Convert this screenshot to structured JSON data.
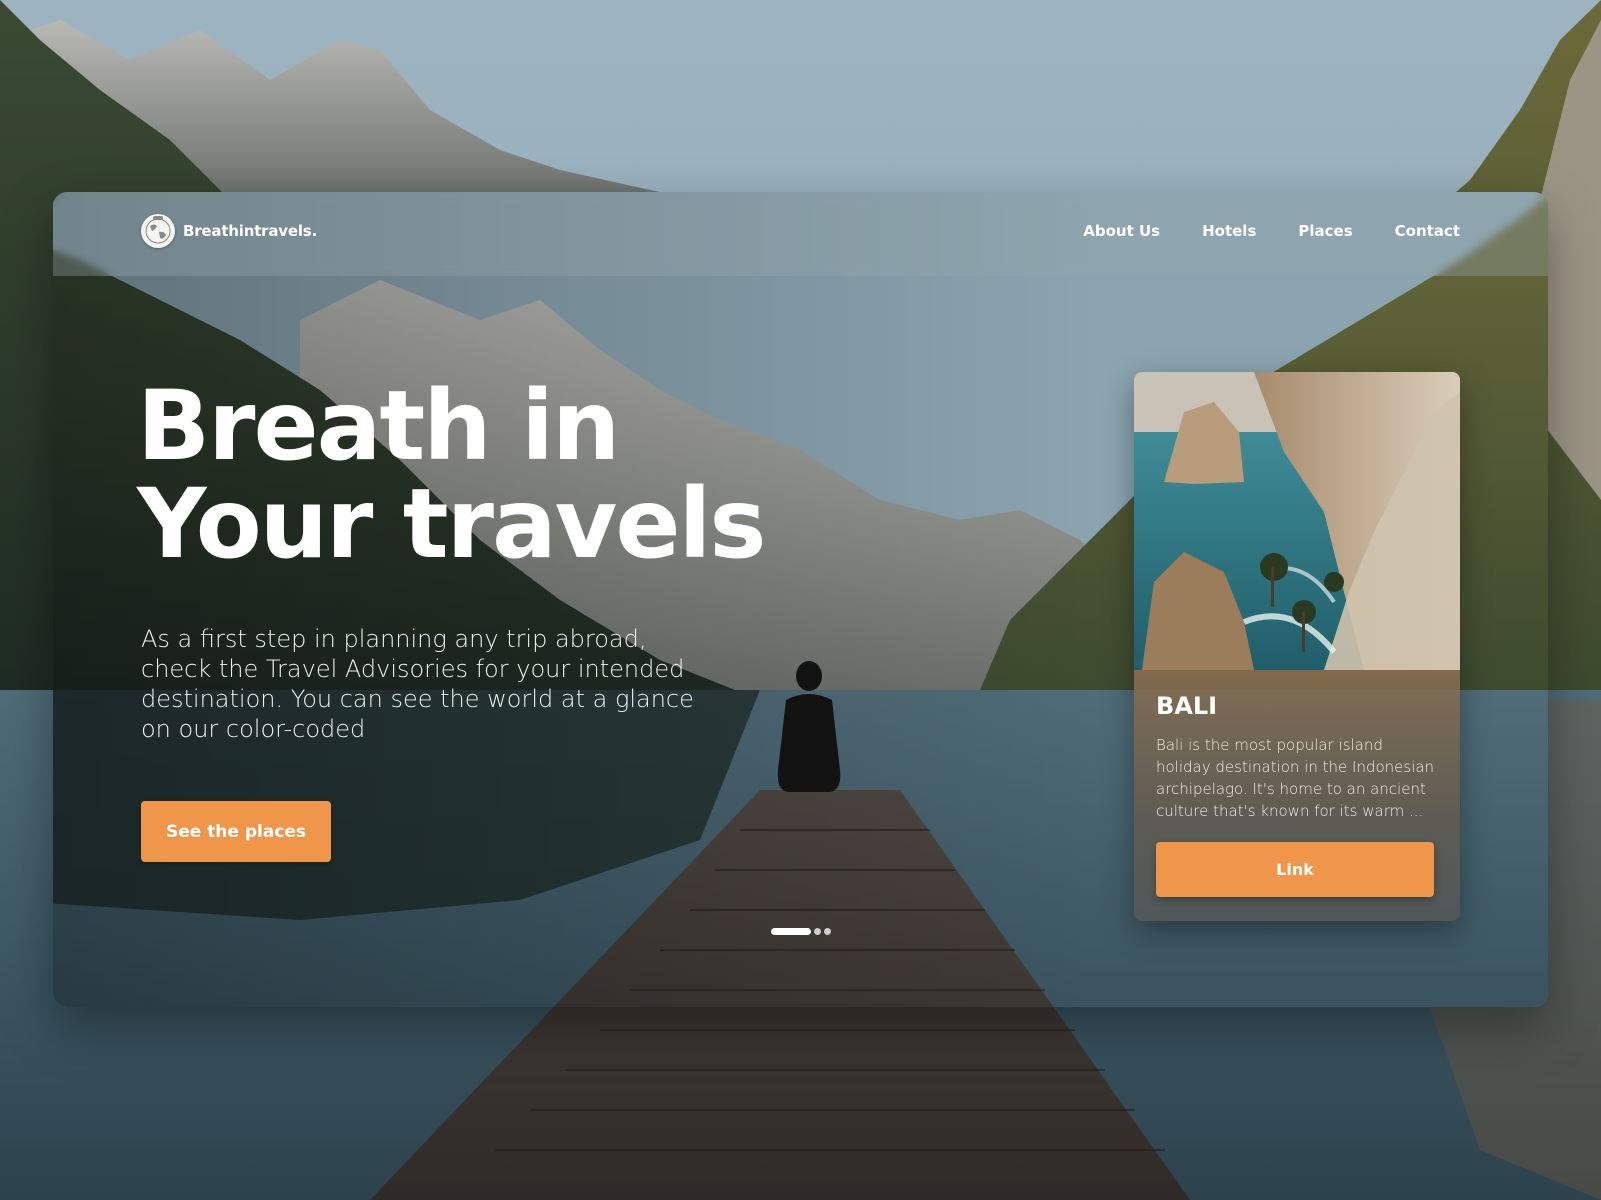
{
  "brand": {
    "name": "Breathintravels.",
    "logo_icon": "globe-icon"
  },
  "nav": {
    "items": [
      {
        "label": "About Us"
      },
      {
        "label": "Hotels"
      },
      {
        "label": "Places"
      },
      {
        "label": "Contact"
      }
    ]
  },
  "hero": {
    "title_line1": "Breath in",
    "title_line2": "Your travels",
    "description": "As a first step in planning any trip abroad, check the Travel Advisories for your intended destination. You can see the world at a glance on our color-coded",
    "cta_label": "See the places"
  },
  "carousel": {
    "slide_count": 3,
    "active_index": 0
  },
  "featured_place": {
    "title": "BALI",
    "description": "Bali is the most popular island holiday destination in the Indonesian archipelago. It's home to an ancient culture that's known for its warm ...",
    "link_label": "Link"
  },
  "colors": {
    "accent": "#f0964b",
    "text": "#ffffff"
  }
}
